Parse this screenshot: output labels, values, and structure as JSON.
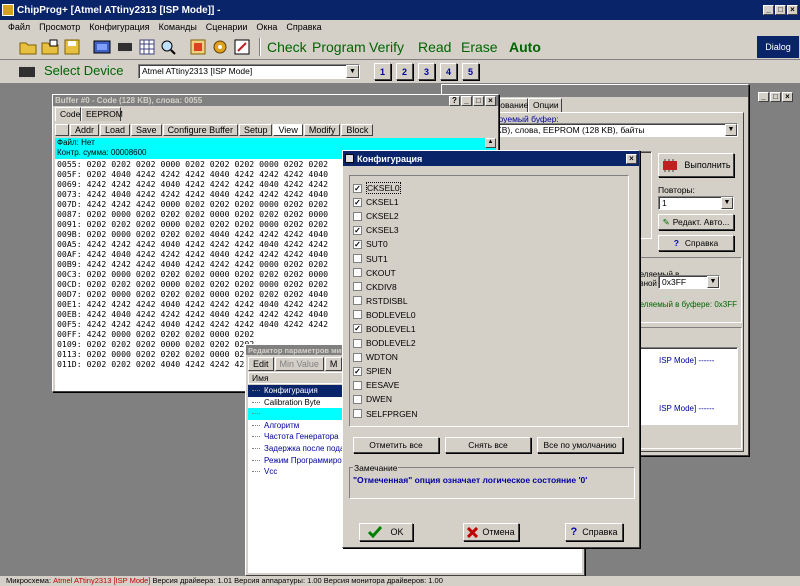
{
  "app": {
    "title": "ChipProg+ [Atmel ATtiny2313  [ISP Mode]] -"
  },
  "menu": [
    "Файл",
    "Просмотр",
    "Конфигурация",
    "Команды",
    "Сценарии",
    "Окна",
    "Справка"
  ],
  "toolbar": {
    "check": "Check",
    "program": "Program",
    "verify": "Verify",
    "read": "Read",
    "erase": "Erase",
    "auto": "Auto",
    "dialog": "Dialog"
  },
  "toolbar2": {
    "select_device": "Select Device",
    "device_value": "Atmel ATtiny2313  [ISP Mode]",
    "slots": [
      "1",
      "2",
      "3",
      "4",
      "5"
    ]
  },
  "buffer": {
    "title": "Buffer #0 - Code (128 KB), слова: 0055",
    "tabs": [
      "Code",
      "EEPROM"
    ],
    "buttons": [
      "Addr",
      "Load",
      "Save",
      "Configure Buffer",
      "Setup",
      "View",
      "Modify",
      "Block"
    ],
    "file_line": "Файл: Нет",
    "checksum_line": "Контр. сумма: 00008600",
    "rows": [
      "0055: 0202 0202 0202 0000 0202 0202 0202 0000 0202 0202",
      "005F: 0202 4040 4242 4242 4242 4040 4242 4242 4242 4040",
      "0069: 4242 4242 4242 4040 4242 4242 4242 4040 4242 4242",
      "0073: 4242 4040 4242 4242 4242 4040 4242 4242 4242 4040",
      "007D: 4242 4242 4242 0000 0202 0202 0202 0000 0202 0202",
      "0087: 0202 0000 0202 0202 0202 0000 0202 0202 0202 0000",
      "0091: 0202 0202 0202 0000 0202 0202 0202 0000 0202 0202",
      "009B: 0202 0000 0202 0202 0202 4040 4242 4242 4242 4040",
      "00A5: 4242 4242 4242 4040 4242 4242 4242 4040 4242 4242",
      "00AF: 4242 4040 4242 4242 4242 4040 4242 4242 4242 4040",
      "00B9: 4242 4242 4242 4040 4242 4242 4242 0000 0202 0202",
      "00C3: 0202 0000 0202 0202 0202 0000 0202 0202 0202 0000",
      "00CD: 0202 0202 0202 0000 0202 0202 0202 0000 0202 0202",
      "00D7: 0202 0000 0202 0202 0202 0000 0202 0202 0202 4040",
      "00E1: 4242 4242 4242 4040 4242 4242 4242 4040 4242 4242",
      "00EB: 4242 4040 4242 4242 4242 4040 4242 4242 4242 4040",
      "00F5: 4242 4242 4242 4040 4242 4242 4242 4040 4242 4242",
      "00FF: 4242 0000 0202 0202 0202 0000 0202",
      "0109: 0202 0202 0202 0000 0202 0202 0202",
      "0113: 0202 0000 0202 0202 0202 0000 0202",
      "011D: 0202 0202 0202 4040 4242 4242 4242"
    ]
  },
  "params": {
    "title": "Редактор параметров микросхемы",
    "buttons": [
      "Edit",
      "Min Value",
      "M"
    ],
    "col_name": "Имя",
    "items": [
      "Конфигурация",
      "Calibration Byte",
      "",
      "Алгоритм",
      "Частота Генератора",
      "Задержка после подачи",
      "Режим Программирования",
      "Vcc"
    ]
  },
  "program_panel": {
    "tabs": [
      "Программирование",
      "Опции"
    ],
    "buffer_label": "Программируемый буфер:",
    "buffer_value": "Code (128 KB), слова, EEPROM (128 KB), байты",
    "execute": "Выполнить",
    "repeats_label": "Повторы:",
    "repeats_value": "1",
    "edit_auto": "Редакт. Авто...",
    "help": "Справка",
    "split_label_a": "Разделяемый в",
    "split_label_b": "основной памяти:",
    "split_value": "0x3FF",
    "buffer_info": "Разделяемый в буфере: 0x3FF",
    "log1": "ISP Mode] ------",
    "log2": "ISP Mode] ------"
  },
  "config": {
    "title": "Конфигурация",
    "options": [
      {
        "label": "CKSEL0",
        "checked": true
      },
      {
        "label": "CKSEL1",
        "checked": true
      },
      {
        "label": "CKSEL2",
        "checked": false
      },
      {
        "label": "CKSEL3",
        "checked": true
      },
      {
        "label": "SUT0",
        "checked": true
      },
      {
        "label": "SUT1",
        "checked": false
      },
      {
        "label": "CKOUT",
        "checked": false
      },
      {
        "label": "CKDIV8",
        "checked": false
      },
      {
        "label": "RSTDISBL",
        "checked": false
      },
      {
        "label": "BODLEVEL0",
        "checked": false
      },
      {
        "label": "BODLEVEL1",
        "checked": true
      },
      {
        "label": "BODLEVEL2",
        "checked": false
      },
      {
        "label": "WDTON",
        "checked": false
      },
      {
        "label": "SPIEN",
        "checked": true
      },
      {
        "label": "EESAVE",
        "checked": false
      },
      {
        "label": "DWEN",
        "checked": false
      },
      {
        "label": "SELFPRGEN",
        "checked": false
      }
    ],
    "btn_mark_all": "Отметить все",
    "btn_clear_all": "Снять все",
    "btn_default": "Все по умолчанию",
    "note_label": "Замечание",
    "note_text": "\"Отмеченная\" опция означает логическое состояние '0'",
    "ok": "OK",
    "cancel": "Отмена",
    "help": "Справка"
  },
  "status": {
    "text_a": "Микросхема: ",
    "device": "Atmel ATtiny2313  [ISP Mode]",
    "text_b": "  Версия драйвера: 1.01  Версия аппаратуры: 1.00  Версия монитора драйверов: 1.00"
  }
}
